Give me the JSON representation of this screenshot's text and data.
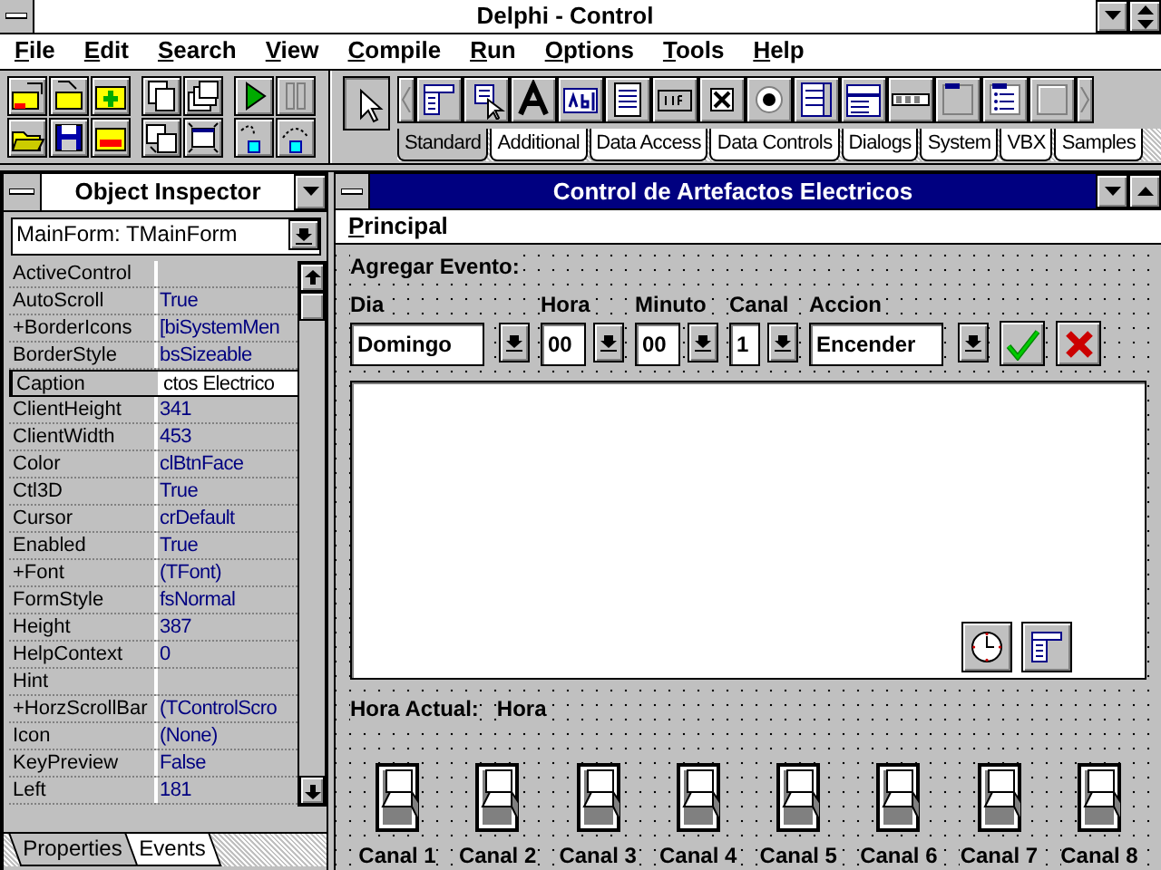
{
  "app": {
    "title": "Delphi - Control"
  },
  "menu": [
    {
      "label": "File"
    },
    {
      "label": "Edit"
    },
    {
      "label": "Search"
    },
    {
      "label": "View"
    },
    {
      "label": "Compile"
    },
    {
      "label": "Run"
    },
    {
      "label": "Options"
    },
    {
      "label": "Tools"
    },
    {
      "label": "Help"
    }
  ],
  "palette": {
    "tabs": [
      {
        "label": "Standard",
        "selected": true
      },
      {
        "label": "Additional",
        "selected": false
      },
      {
        "label": "Data Access",
        "selected": false
      },
      {
        "label": "Data Controls",
        "selected": false
      },
      {
        "label": "Dialogs",
        "selected": false
      },
      {
        "label": "System",
        "selected": false
      },
      {
        "label": "VBX",
        "selected": false
      },
      {
        "label": "Samples",
        "selected": false
      }
    ]
  },
  "inspector": {
    "title": "Object Inspector",
    "object": "MainForm: TMainForm",
    "properties": [
      {
        "name": "ActiveControl",
        "selected": false
      },
      {
        "name": "AutoScroll",
        "value": "True",
        "selected": false
      },
      {
        "name": "+BorderIcons",
        "value": "[biSystemMen",
        "selected": false
      },
      {
        "name": "BorderStyle",
        "value": "bsSizeable",
        "selected": false
      },
      {
        "name": "Caption",
        "value": "ctos Electrico",
        "selected": true
      },
      {
        "name": "ClientHeight",
        "value": "341",
        "selected": false
      },
      {
        "name": "ClientWidth",
        "value": "453",
        "selected": false
      },
      {
        "name": "Color",
        "value": "clBtnFace",
        "selected": false
      },
      {
        "name": "Ctl3D",
        "value": "True",
        "selected": false
      },
      {
        "name": "Cursor",
        "value": "crDefault",
        "selected": false
      },
      {
        "name": "Enabled",
        "value": "True",
        "selected": false
      },
      {
        "name": "+Font",
        "value": "(TFont)",
        "selected": false
      },
      {
        "name": "FormStyle",
        "value": "fsNormal",
        "selected": false
      },
      {
        "name": "Height",
        "value": "387",
        "selected": false
      },
      {
        "name": "HelpContext",
        "value": "0",
        "selected": false
      },
      {
        "name": "Hint",
        "selected": false
      },
      {
        "name": "+HorzScrollBar",
        "value": "(TControlScro",
        "selected": false
      },
      {
        "name": "Icon",
        "value": "(None)",
        "selected": false
      },
      {
        "name": "KeyPreview",
        "value": "False",
        "selected": false
      },
      {
        "name": "Left",
        "value": "181",
        "selected": false
      }
    ],
    "tabs": [
      {
        "label": "Properties",
        "selected": true
      },
      {
        "label": "Events",
        "selected": false
      }
    ]
  },
  "form": {
    "title": "Control de Artefactos Electricos",
    "menu": [
      {
        "label": "Principal"
      }
    ],
    "section_label": "Agregar Evento:",
    "fields": [
      {
        "label": "Dia",
        "value": "Domingo",
        "kind": "wide"
      },
      {
        "label": "Hora",
        "value": "00",
        "kind": "narrow"
      },
      {
        "label": "Minuto",
        "value": "00",
        "kind": "narrow"
      },
      {
        "label": "Canal",
        "value": "1",
        "kind": "tiny"
      },
      {
        "label": "Accion",
        "value": "Encender",
        "kind": "wide"
      }
    ],
    "current_time_label": "Hora Actual:",
    "current_time": "Hora",
    "channels": [
      {
        "label": "Canal 1",
        "on": false
      },
      {
        "label": "Canal 2",
        "on": false
      },
      {
        "label": "Canal 3",
        "on": false
      },
      {
        "label": "Canal 4",
        "on": false
      },
      {
        "label": "Canal 5",
        "on": false
      },
      {
        "label": "Canal 6",
        "on": false
      },
      {
        "label": "Canal 7",
        "on": false
      },
      {
        "label": "Canal 8",
        "on": false
      }
    ]
  }
}
